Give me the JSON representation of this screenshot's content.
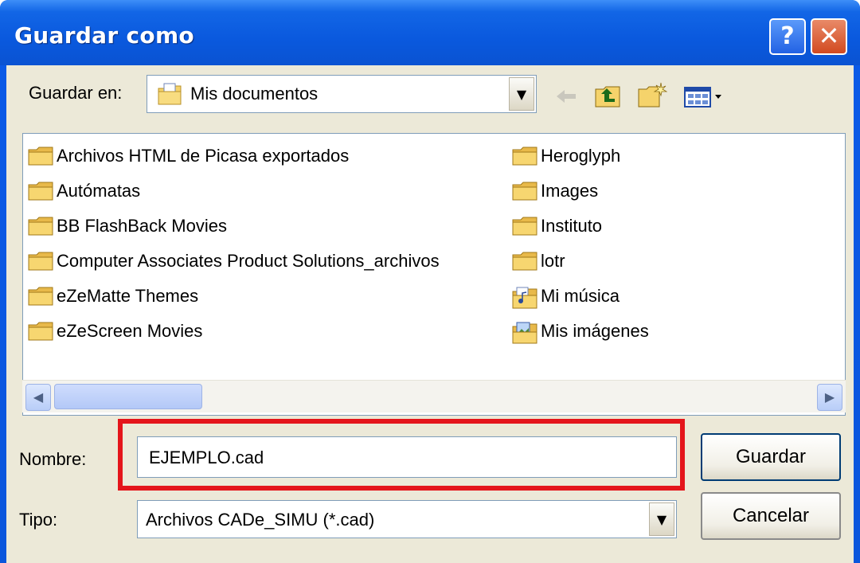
{
  "window": {
    "title": "Guardar como",
    "help_symbol": "?",
    "close_symbol": "✕"
  },
  "location": {
    "label": "Guardar en:",
    "value": "Mis documentos"
  },
  "toolbar": {
    "icons": [
      "back-icon",
      "up-folder-icon",
      "new-folder-icon",
      "views-menu-icon"
    ]
  },
  "files": {
    "column1": [
      "Archivos HTML de Picasa exportados",
      "Autómatas",
      "BB FlashBack Movies",
      "Computer Associates Product Solutions_archivos",
      "eZeMatte Themes",
      "eZeScreen Movies"
    ],
    "column2": [
      "Heroglyph",
      "Images",
      "Instituto",
      "lotr",
      "Mi música",
      "Mis imágenes"
    ]
  },
  "filename": {
    "label": "Nombre:",
    "value": "EJEMPLO.cad"
  },
  "filetype": {
    "label": "Tipo:",
    "value": "Archivos CADe_SIMU (*.cad)"
  },
  "buttons": {
    "save": "Guardar",
    "cancel": "Cancelar"
  },
  "colors": {
    "title_bar": "#0a59de",
    "highlight": "#e4151b",
    "folder": "#f5d36b",
    "dialog_bg": "#ece9d8"
  }
}
